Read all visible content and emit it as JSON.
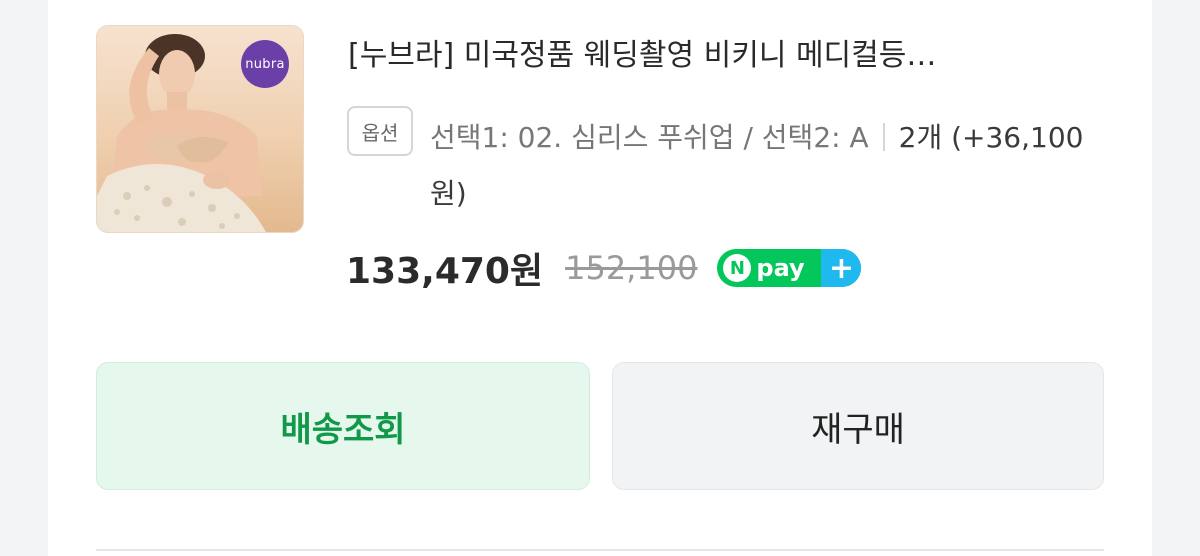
{
  "product": {
    "image_alt": "product-photo",
    "brand_badge": "nubra",
    "title": "[누브라] 미국정품 웨딩촬영 비키니 메디컬등…",
    "option_badge": "옵션",
    "option_text": "선택1: 02. 심리스 푸쉬업 / 선택2: A",
    "option_qty": "2개 (+36,100원)",
    "price": "133,470원",
    "original_price": "152,100",
    "npay": {
      "n": "N",
      "label": "pay",
      "plus": "+"
    }
  },
  "actions": {
    "track_label": "배송조회",
    "rebuy_label": "재구매"
  },
  "colors": {
    "npay_green": "#03c75a",
    "npay_blue": "#1fb9ef",
    "track_text": "#11994a",
    "track_bg": "#e6f7ee",
    "brand_purple": "#6b3fa8"
  }
}
